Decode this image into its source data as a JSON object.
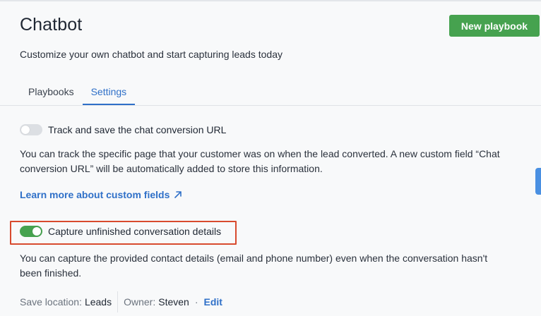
{
  "header": {
    "title": "Chatbot",
    "new_button_label": "New playbook",
    "subtitle": "Customize your own chatbot and start capturing leads today"
  },
  "tabs": [
    {
      "label": "Playbooks",
      "active": false
    },
    {
      "label": "Settings",
      "active": true
    }
  ],
  "settings": {
    "track_url": {
      "label": "Track and save the chat conversion URL",
      "enabled": false,
      "description": "You can track the specific page that your customer was on when the lead converted. A new custom field “Chat conversion URL” will be automatically added to store this information.",
      "link_label": "Learn more about custom fields"
    },
    "capture_unfinished": {
      "label": "Capture unfinished conversation details",
      "enabled": true,
      "description": "You can capture the provided contact details (email and phone number) even when the conversation hasn't been finished."
    }
  },
  "meta": {
    "save_location_label": "Save location:",
    "save_location_value": "Leads",
    "owner_label": "Owner:",
    "owner_value": "Steven",
    "separator": "·",
    "edit_label": "Edit"
  },
  "colors": {
    "accent_green": "#46a24f",
    "link_blue": "#2f70c8",
    "highlight_red": "#d84a2e"
  },
  "icons": {
    "external_link": "arrow-up-right-icon"
  }
}
